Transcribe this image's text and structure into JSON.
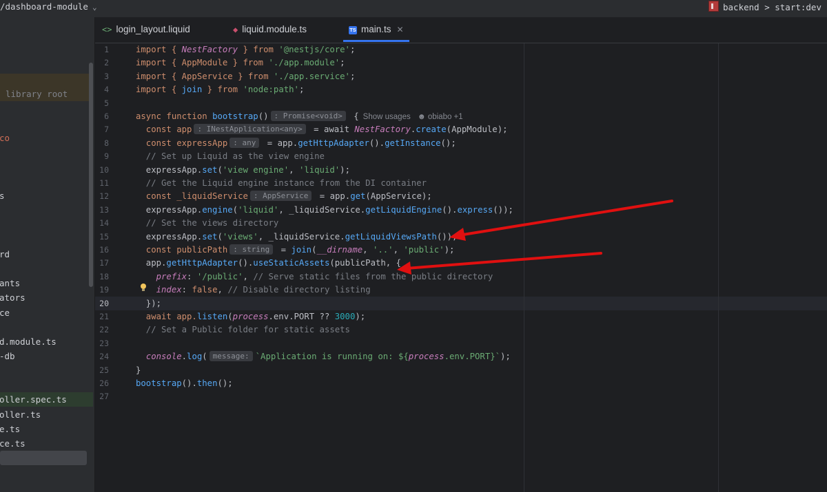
{
  "titlebar": {
    "project_path": "/dashboard-module",
    "run_config": "backend > start:dev"
  },
  "project_panel": {
    "rows": [
      "library root",
      "co",
      "s",
      "rd",
      "ants",
      "ators",
      "ce",
      "d.module.ts",
      "-db",
      "oller.spec.ts",
      "oller.ts",
      "e.ts",
      "ce.ts"
    ]
  },
  "tabs": [
    {
      "icon": "<>",
      "label": "login_layout.liquid"
    },
    {
      "icon": "module",
      "label": "liquid.module.ts"
    },
    {
      "icon": "TS",
      "label": "main.ts"
    }
  ],
  "editor": {
    "current_line": 20,
    "line_numbers": [
      "1",
      "2",
      "3",
      "4",
      "5",
      "6",
      "7",
      "8",
      "9",
      "10",
      "11",
      "12",
      "13",
      "14",
      "15",
      "16",
      "17",
      "18",
      "19",
      "20",
      "21",
      "22",
      "23",
      "24",
      "25",
      "26",
      "27"
    ],
    "hints": {
      "promise_void": ": Promise<void>",
      "inest_app": ": INestApplication<any>",
      "any": ": any",
      "app_service": ": AppService",
      "string": ": string",
      "message": "message:"
    },
    "codelens": {
      "usages": "Show usages",
      "author": "obiabo +1"
    },
    "code": {
      "l1": [
        "import { ",
        "NestFactory",
        " } from ",
        "'@nestjs/core'",
        ";"
      ],
      "l2": [
        "import { AppModule } from ",
        "'./app.module'",
        ";"
      ],
      "l3": [
        "import { AppService } from ",
        "'./app.service'",
        ";"
      ],
      "l4": [
        "import { ",
        "join",
        " } from ",
        "'node:path'",
        ";"
      ],
      "l6": [
        "async function ",
        "bootstrap",
        "()",
        " {"
      ],
      "l7": [
        "  const app",
        " = await ",
        "NestFactory",
        ".",
        "create",
        "(AppModule);"
      ],
      "l8": [
        "  const expressApp",
        " = app.",
        "getHttpAdapter",
        "().",
        "getInstance",
        "();"
      ],
      "l9": "  // Set up Liquid as the view engine",
      "l10": [
        "  expressApp.",
        "set",
        "(",
        "'view engine'",
        ", ",
        "'liquid'",
        ");"
      ],
      "l11": "  // Get the Liquid engine instance from the DI container",
      "l12": [
        "  const _liquidService",
        " = app.",
        "get",
        "(AppService);"
      ],
      "l13": [
        "  expressApp.",
        "engine",
        "(",
        "'liquid'",
        ", _liquidService.",
        "getLiquidEngine",
        "().",
        "express",
        "());"
      ],
      "l14": "  // Set the views directory",
      "l15": [
        "  expressApp.",
        "set",
        "(",
        "'views'",
        ", _liquidService.",
        "getLiquidViewsPath",
        "());"
      ],
      "l16": [
        "  const publicPath",
        " = ",
        "join",
        "(",
        "__dirname",
        ", ",
        "'..'",
        ", ",
        "'public'",
        ");"
      ],
      "l17": [
        "  app.",
        "getHttpAdapter",
        "().",
        "useStaticAssets",
        "(publicPath, {"
      ],
      "l18": [
        "    ",
        "prefix",
        ": ",
        "'/public'",
        ", ",
        "// Serve static files from the public directory"
      ],
      "l19": [
        "    ",
        "index",
        ": ",
        "false",
        ", ",
        "// Disable directory listing"
      ],
      "l20": "  });",
      "l21": [
        "  await app.",
        "listen",
        "(",
        "process",
        ".env.PORT ?? ",
        "3000",
        ");"
      ],
      "l22": "  // Set a Public folder for static assets",
      "l24": [
        "  ",
        "console",
        ".",
        "log",
        "(",
        "`Application is running on: ${",
        "process",
        ".env.PORT}`",
        ");"
      ],
      "l25": "}",
      "l26": [
        "bootstrap",
        "().",
        "then",
        "();"
      ]
    }
  },
  "colors": {
    "keyword": "#cf8e6d",
    "string": "#6aab73",
    "function": "#56a8f5",
    "comment": "#7a7e85",
    "annotation_arrow": "#e01010",
    "tab_underline": "#3574f0"
  }
}
